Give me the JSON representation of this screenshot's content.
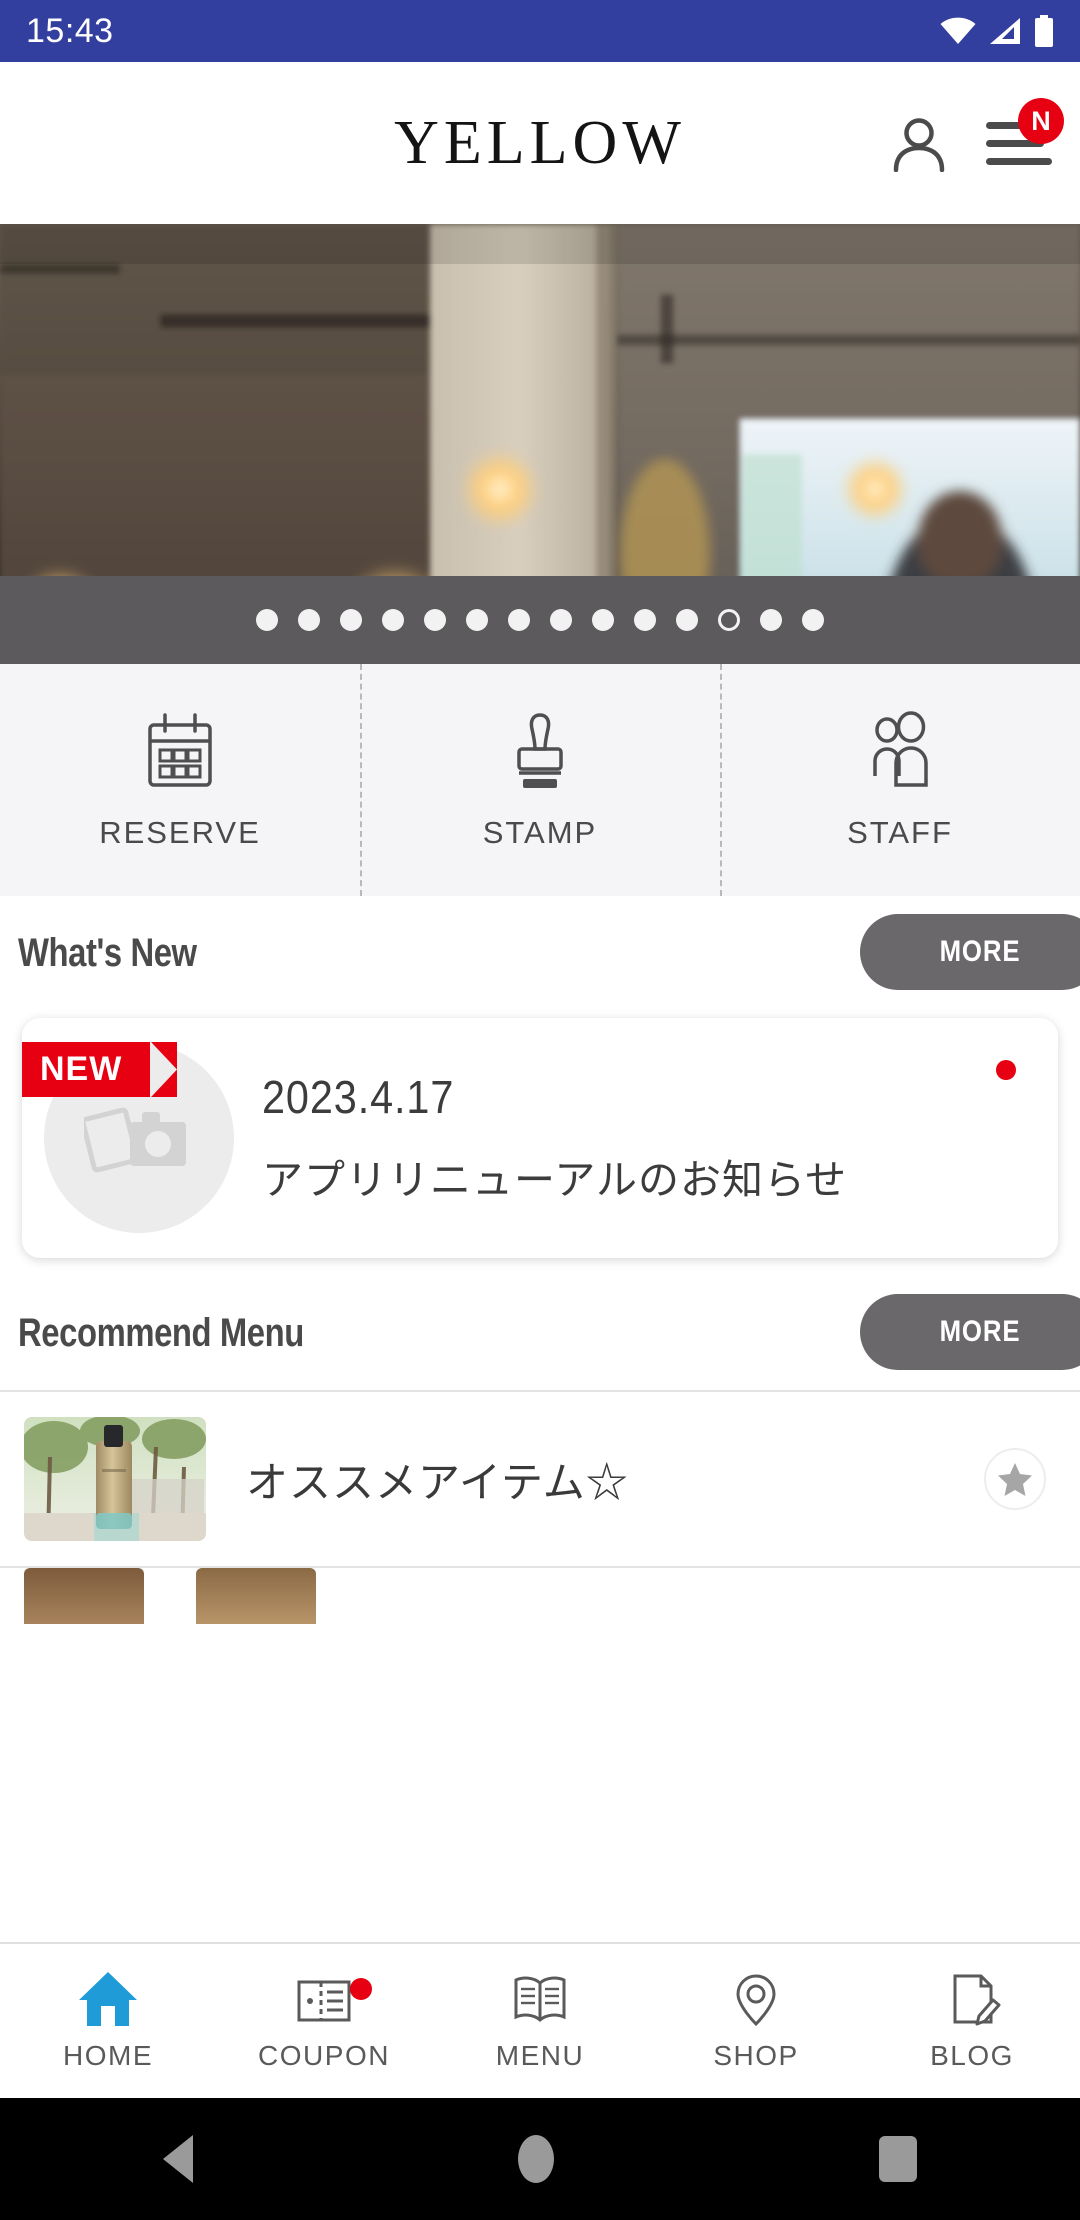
{
  "status_bar": {
    "time": "15:43",
    "icons": [
      "wifi-icon",
      "signal-icon",
      "battery-icon"
    ],
    "background": "#333f9e"
  },
  "header": {
    "brand": "YELLOW",
    "account_icon": "person-icon",
    "menu_icon": "hamburger-icon",
    "menu_badge": "N",
    "badge_color": "#e60012"
  },
  "hero": {
    "alt": "salon interior with pendant lights",
    "dot_count": 14,
    "active_index": 11
  },
  "quick_actions": [
    {
      "label": "RESERVE",
      "icon": "calendar-icon"
    },
    {
      "label": "STAMP",
      "icon": "stamp-icon"
    },
    {
      "label": "STAFF",
      "icon": "staff-icon"
    }
  ],
  "whats_new": {
    "title": "What's New",
    "more_label": "MORE",
    "items": [
      {
        "badge": "NEW",
        "date": "2023.4.17",
        "title": "アプリリニューアルのお知らせ",
        "thumb_icon": "photo-placeholder-icon",
        "unread": true
      }
    ]
  },
  "recommend_menu": {
    "title": "Recommend Menu",
    "more_label": "MORE",
    "items": [
      {
        "name": "オススメアイテム☆",
        "favorite_icon": "star-icon"
      }
    ]
  },
  "bottom_nav": [
    {
      "label": "HOME",
      "icon": "home-icon",
      "active": true,
      "badge": false
    },
    {
      "label": "COUPON",
      "icon": "coupon-icon",
      "active": false,
      "badge": true
    },
    {
      "label": "MENU",
      "icon": "book-icon",
      "active": false,
      "badge": false
    },
    {
      "label": "SHOP",
      "icon": "location-icon",
      "active": false,
      "badge": false
    },
    {
      "label": "BLOG",
      "icon": "document-icon",
      "active": false,
      "badge": false
    }
  ],
  "android_nav": {
    "back": "back-icon",
    "home": "home-circle-icon",
    "recents": "recents-icon"
  },
  "colors": {
    "status_blue": "#333f9e",
    "accent_red": "#e60012",
    "more_gray": "#6b686b",
    "home_blue": "#1f9cd7"
  }
}
